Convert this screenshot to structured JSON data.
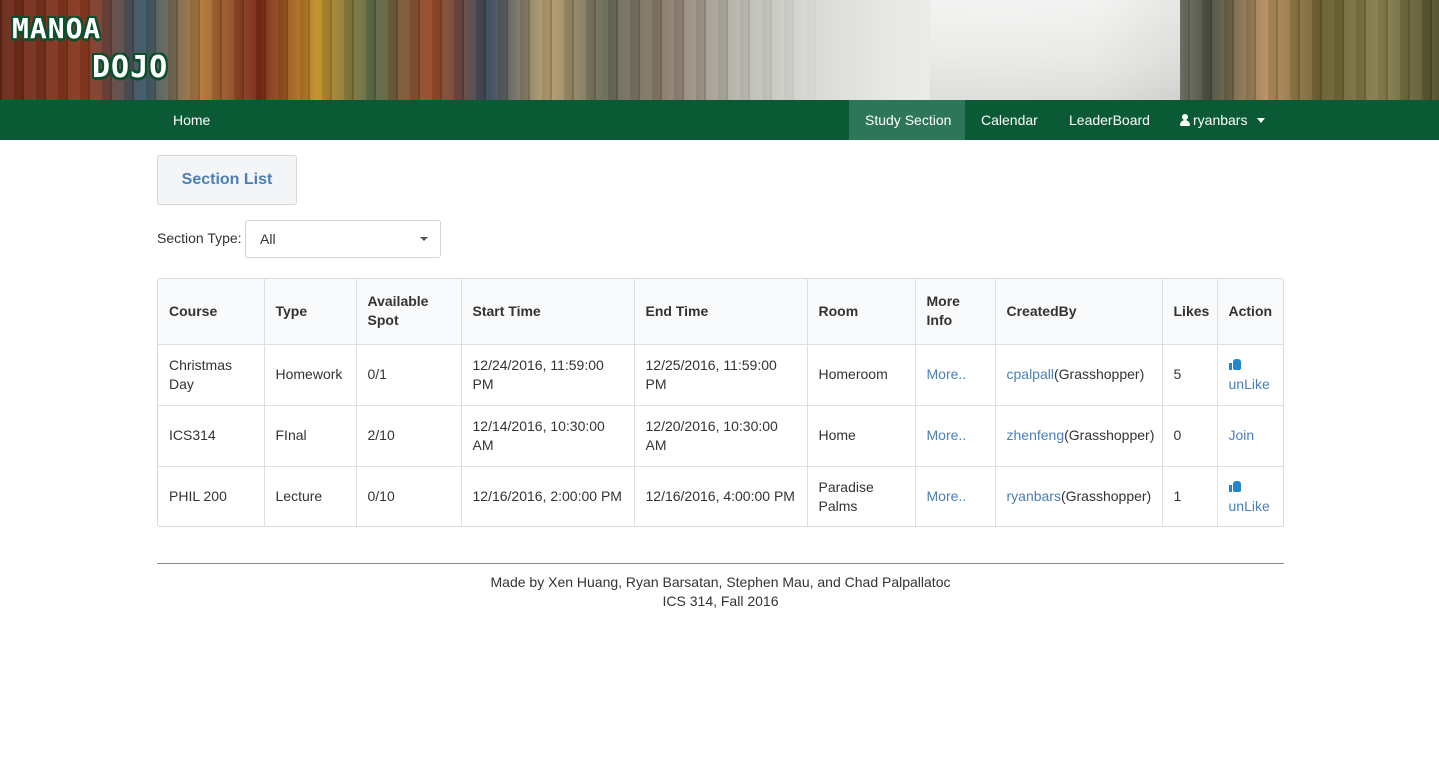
{
  "brand": {
    "logo_line1": "MANOA",
    "logo_line2": "DOJO"
  },
  "nav": {
    "home": "Home",
    "study_section": "Study Section",
    "calendar": "Calendar",
    "leaderboard": "LeaderBoard",
    "user": "ryanbars"
  },
  "section_header": "Section List",
  "filter": {
    "label": "Section Type:",
    "value": "All"
  },
  "table": {
    "headers": [
      "Course",
      "Type",
      "Available Spot",
      "Start Time",
      "End Time",
      "Room",
      "More Info",
      "CreatedBy",
      "Likes",
      "Action"
    ],
    "rows": [
      {
        "course": "Christmas Day",
        "type": "Homework",
        "available": "0/1",
        "start": "12/24/2016, 11:59:00 PM",
        "end": "12/25/2016, 11:59:00 PM",
        "room": "Homeroom",
        "more": "More..",
        "creator": "cpalpall",
        "role": "(Grasshopper)",
        "likes": "5",
        "action": "unLike"
      },
      {
        "course": "ICS314",
        "type": "FInal",
        "available": "2/10",
        "start": "12/14/2016, 10:30:00 AM",
        "end": "12/20/2016, 10:30:00 AM",
        "room": "Home",
        "more": "More..",
        "creator": "zhenfeng",
        "role": "(Grasshopper)",
        "likes": "0",
        "action": "Join"
      },
      {
        "course": "PHIL 200",
        "type": "Lecture",
        "available": "0/10",
        "start": "12/16/2016, 2:00:00 PM",
        "end": "12/16/2016, 4:00:00 PM",
        "room": "Paradise Palms",
        "more": "More..",
        "creator": "ryanbars",
        "role": "(Grasshopper)",
        "likes": "1",
        "action": "unLike"
      }
    ]
  },
  "footer": {
    "line1": "Made by Xen Huang, Ryan Barsatan, Stephen Mau, and Chad Palpallatoc",
    "line2": "ICS 314, Fall 2016"
  },
  "colors": {
    "nav_bg": "#0a5a36",
    "nav_active": "#2e7659",
    "link": "#4a7fb8",
    "thumb": "#2185d0"
  },
  "icons": {
    "user": "user-icon",
    "like": "thumbs-up-icon",
    "dropdown": "caret-down-icon"
  }
}
